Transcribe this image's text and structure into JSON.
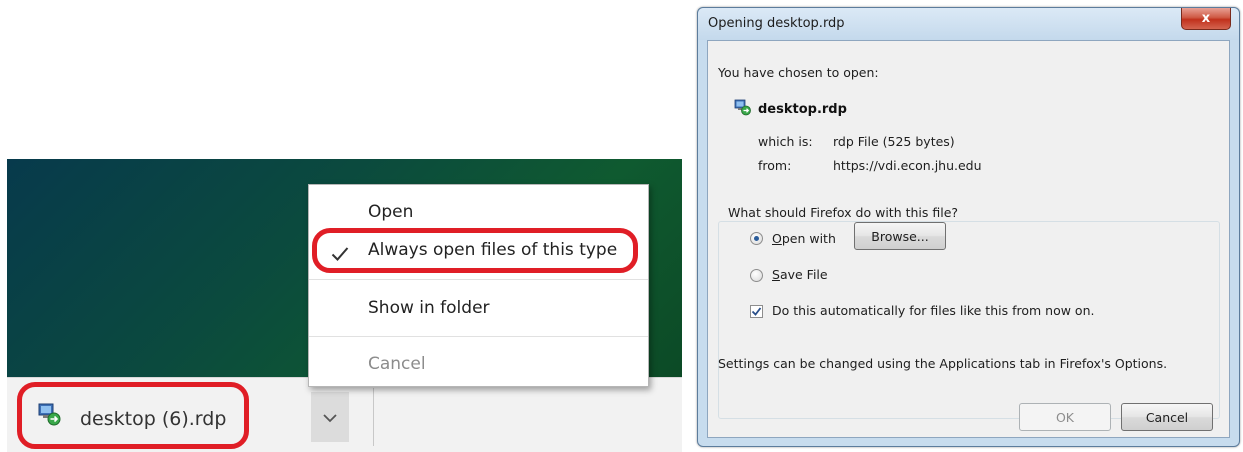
{
  "chrome": {
    "download_item": {
      "name": "desktop (6).rdp",
      "icon": "rdp-file-icon"
    },
    "context_menu": {
      "items": [
        {
          "label": "Open",
          "checked": false,
          "disabled": false
        },
        {
          "label": "Always open files of this type",
          "checked": true,
          "disabled": false
        },
        {
          "label": "Show in folder",
          "checked": false,
          "disabled": false
        },
        {
          "label": "Cancel",
          "checked": false,
          "disabled": true
        }
      ]
    },
    "annotation_color": "#e01e26"
  },
  "firefox_dialog": {
    "title": "Opening desktop.rdp",
    "close_label": "x",
    "intro": "You have chosen to open:",
    "file_name": "desktop.rdp",
    "which_is_label": "which is:",
    "which_is_value": "rdp File (525 bytes)",
    "from_label": "from:",
    "from_value": "https://vdi.econ.jhu.edu",
    "group_label": "What should Firefox do with this file?",
    "open_with_label": "Open with",
    "open_with_selected": true,
    "browse_label": "Browse...",
    "save_file_label": "Save File",
    "auto_checkbox_label": "Do this automatically for files like this from now on.",
    "auto_checked": true,
    "settings_note": "Settings can be changed using the Applications tab in Firefox's Options.",
    "ok_label": "OK",
    "cancel_label": "Cancel"
  }
}
